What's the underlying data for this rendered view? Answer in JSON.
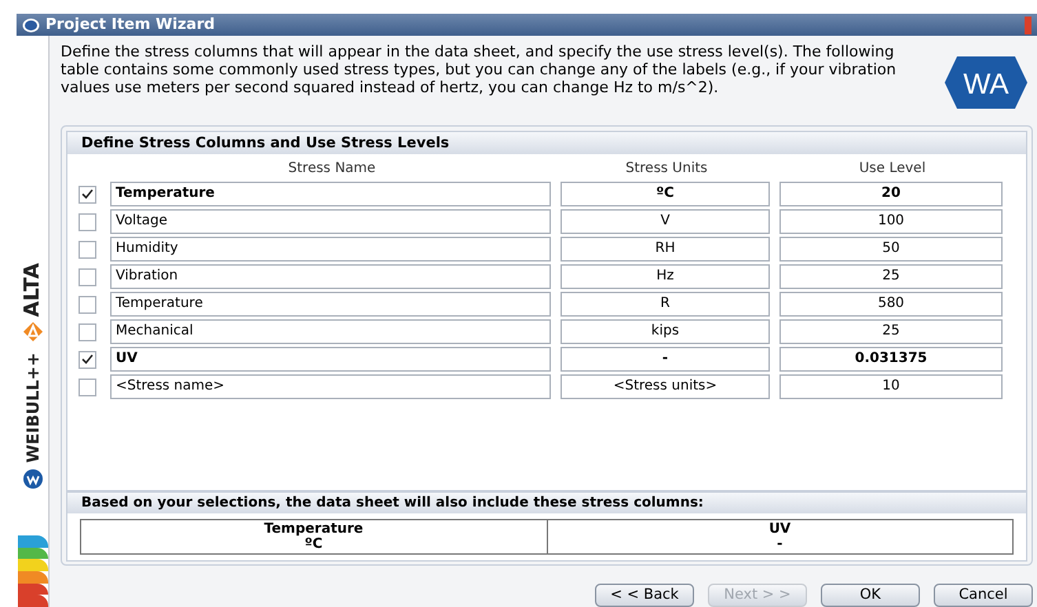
{
  "window": {
    "title": "Project Item Wizard"
  },
  "sidebar": {
    "labels": [
      "ALTA",
      "WEIBULL++"
    ]
  },
  "logo_text": "WA",
  "instructions": "Define the stress columns that will appear in the data sheet, and specify the use stress level(s). The following table contains some commonly used stress types, but you can change any of the labels (e.g., if your vibration values use meters per second squared instead of hertz, you can change Hz to m/s^2).",
  "stress_table": {
    "title": "Define Stress Columns and Use Stress Levels",
    "columns": [
      "Stress Name",
      "Stress Units",
      "Use Level"
    ],
    "rows": [
      {
        "checked": true,
        "name": "Temperature",
        "units": "ºC",
        "use_level": "20"
      },
      {
        "checked": false,
        "name": "Voltage",
        "units": "V",
        "use_level": "100"
      },
      {
        "checked": false,
        "name": "Humidity",
        "units": "RH",
        "use_level": "50"
      },
      {
        "checked": false,
        "name": "Vibration",
        "units": "Hz",
        "use_level": "25"
      },
      {
        "checked": false,
        "name": "Temperature",
        "units": "R",
        "use_level": "580"
      },
      {
        "checked": false,
        "name": "Mechanical",
        "units": "kips",
        "use_level": "25"
      },
      {
        "checked": true,
        "name": "UV",
        "units": "-",
        "use_level": "0.031375"
      },
      {
        "checked": false,
        "name": "<Stress name>",
        "units": "<Stress units>",
        "use_level": "10"
      }
    ]
  },
  "summary": {
    "title": "Based on your selections, the data sheet will also include these stress columns:",
    "columns": [
      {
        "name": "Temperature",
        "units": "ºC"
      },
      {
        "name": "UV",
        "units": "-"
      }
    ]
  },
  "buttons": [
    {
      "label": "< < Back",
      "disabled": false
    },
    {
      "label": "Next > >",
      "disabled": true
    },
    {
      "label": "OK",
      "disabled": false
    },
    {
      "label": "Cancel",
      "disabled": false
    }
  ]
}
